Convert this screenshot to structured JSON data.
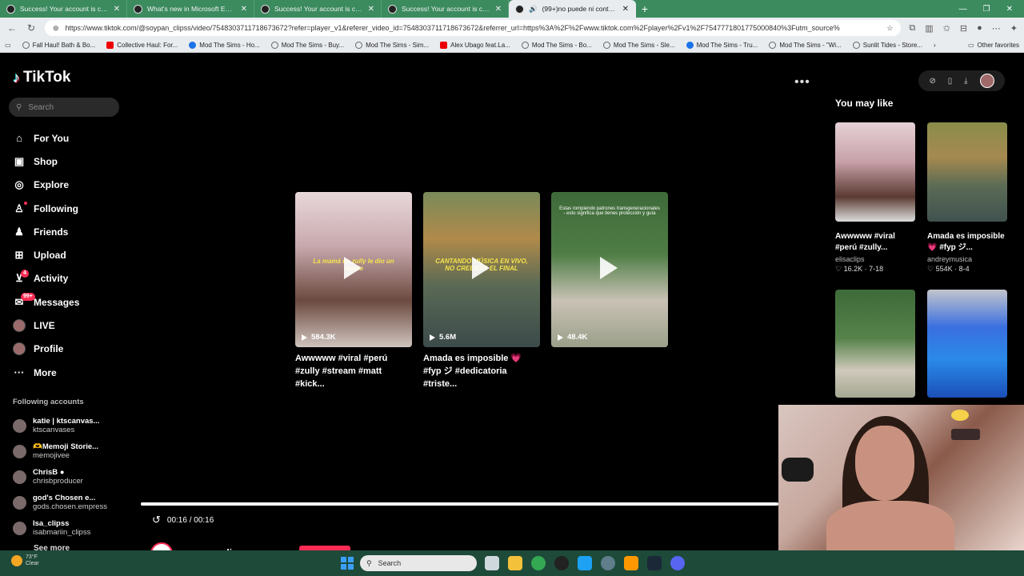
{
  "browser": {
    "tabs": [
      {
        "title": "Success! Your account is connect",
        "active": false
      },
      {
        "title": "What's new in Microsoft Edge",
        "active": false
      },
      {
        "title": "Success! Your account is connect",
        "active": false
      },
      {
        "title": "Success! Your account is connect",
        "active": false
      },
      {
        "title": "(99+)no puede ni contra yo",
        "active": true
      }
    ],
    "url": "https://www.tiktok.com/@soypan_clipss/video/7548303711718673672?refer=player_v1&referer_video_id=7548303711718673672&referrer_url=https%3A%2F%2Fwww.tiktok.com%2Fplayer%2Fv1%2F7547771801775000840%3Futm_source%",
    "bookmarks": [
      {
        "label": "Fall Haul! Bath & Bo...",
        "icon": "globe-icon"
      },
      {
        "label": "Collective Haul: For...",
        "icon": "youtube-icon"
      },
      {
        "label": "Mod The Sims - Ho...",
        "icon": "ea-icon"
      },
      {
        "label": "Mod The Sims - Buy...",
        "icon": "globe-icon"
      },
      {
        "label": "Mod The Sims - Sim...",
        "icon": "globe-icon"
      },
      {
        "label": "Alex Ubago feat.La...",
        "icon": "youtube-icon"
      },
      {
        "label": "Mod The Sims - Bo...",
        "icon": "globe-icon"
      },
      {
        "label": "Mod The Sims - Sle...",
        "icon": "globe-icon"
      },
      {
        "label": "Mod The Sims - Tru...",
        "icon": "ea-icon"
      },
      {
        "label": "Mod The Sims - \"Wi...",
        "icon": "globe-icon"
      },
      {
        "label": "Sunlit Tides - Store...",
        "icon": "globe-icon"
      }
    ],
    "other_favorites": "Other favorites"
  },
  "tiktok": {
    "logo": "TikTok",
    "search_placeholder": "Search",
    "nav": [
      {
        "label": "For You",
        "icon": "home-icon",
        "glyph": "⌂"
      },
      {
        "label": "Shop",
        "icon": "shop-icon",
        "glyph": "▣"
      },
      {
        "label": "Explore",
        "icon": "compass-icon",
        "glyph": "◎"
      },
      {
        "label": "Following",
        "icon": "following-icon",
        "glyph": "♙"
      },
      {
        "label": "Friends",
        "icon": "friends-icon",
        "glyph": "♟"
      },
      {
        "label": "Upload",
        "icon": "upload-icon",
        "glyph": "⊞"
      },
      {
        "label": "Activity",
        "icon": "activity-icon",
        "glyph": "⊻",
        "badge": "4"
      },
      {
        "label": "Messages",
        "icon": "messages-icon",
        "glyph": "✉",
        "badge": "99+"
      },
      {
        "label": "LIVE",
        "icon": "live-icon",
        "glyph": "●"
      },
      {
        "label": "Profile",
        "icon": "profile-icon",
        "glyph": "●"
      },
      {
        "label": "More",
        "icon": "more-icon",
        "glyph": "···"
      }
    ],
    "following_title": "Following accounts",
    "following": [
      {
        "name": "katie | ktscanvas...",
        "user": "ktscanvases"
      },
      {
        "name": "🫶Memoji Storie...",
        "user": "memojivee"
      },
      {
        "name": "ChrisB ●",
        "user": "chrisbproducer"
      },
      {
        "name": "god's Chosen e...",
        "user": "gods.chosen.empress"
      },
      {
        "name": "Isa_clipss",
        "user": "isabmariin_clipss"
      }
    ],
    "see_more": "See more"
  },
  "main": {
    "videos": [
      {
        "views": "584.3K",
        "caption": "Awwwww #viral #perú #zully #stream #matt #kick...",
        "overlay": "La mamá de zully le dio un regalo"
      },
      {
        "views": "5.6M",
        "caption": "Amada es imposible 💗 #fyp ジ #dedicatoria #triste...",
        "overlay": "CANTANDO MÚSICA EN VIVO, NO CREERÁS EL FINAL"
      },
      {
        "views": "48.4K",
        "caption": "",
        "overlay": "Estas rompiendo patrones transgeneracionales - esto significa que tienes protección y guía"
      }
    ],
    "progress": 1.0,
    "time": "00:16 / 00:16",
    "author": "soypan_clipss"
  },
  "right": {
    "title": "You may like",
    "cards": [
      {
        "caption": "Awwwww #viral #perú #zully...",
        "author": "elisaclips",
        "likes": "16.2K",
        "date": "7-18"
      },
      {
        "caption": "Amada es imposible 💗 #fyp ジ...",
        "author": "andreymusica",
        "likes": "554K",
        "date": "8-4"
      },
      {
        "caption": "",
        "author": "",
        "likes": "",
        "date": ""
      },
      {
        "caption": "",
        "author": "",
        "likes": "",
        "date": ""
      }
    ]
  },
  "taskbar": {
    "weather_temp": "73°F",
    "weather_desc": "Clear",
    "search": "Search"
  }
}
